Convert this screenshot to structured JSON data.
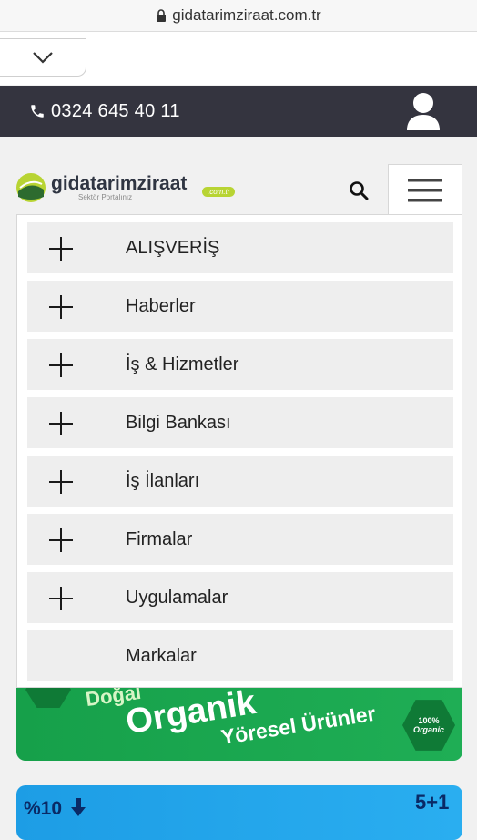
{
  "browser": {
    "url": "gidatarimziraat.com.tr"
  },
  "topbar": {
    "phone": "0324 645 40 11"
  },
  "logo": {
    "name": "gidatarimziraat",
    "subtitle": "Sektör Portalınız",
    "badge": ".com.tr"
  },
  "menu": {
    "items": [
      {
        "label": "ALIŞVERİŞ",
        "expandable": true
      },
      {
        "label": "Haberler",
        "expandable": true
      },
      {
        "label": "İş & Hizmetler",
        "expandable": true
      },
      {
        "label": "Bilgi Bankası",
        "expandable": true
      },
      {
        "label": "İş İlanları",
        "expandable": true
      },
      {
        "label": "Firmalar",
        "expandable": true
      },
      {
        "label": "Uygulamalar",
        "expandable": true
      },
      {
        "label": "Markalar",
        "expandable": false
      }
    ]
  },
  "banner_green": {
    "line1": "Doğal",
    "line2": "Organik",
    "line3": "Yöresel Ürünler",
    "badge_top": "100%",
    "badge_bottom": "Organic"
  },
  "banner_blue": {
    "discount": "%10",
    "offer": "5+1"
  },
  "colors": {
    "topbar": "#34343f",
    "green_banner": "#16a04a",
    "blue_banner": "#1d9de5"
  }
}
